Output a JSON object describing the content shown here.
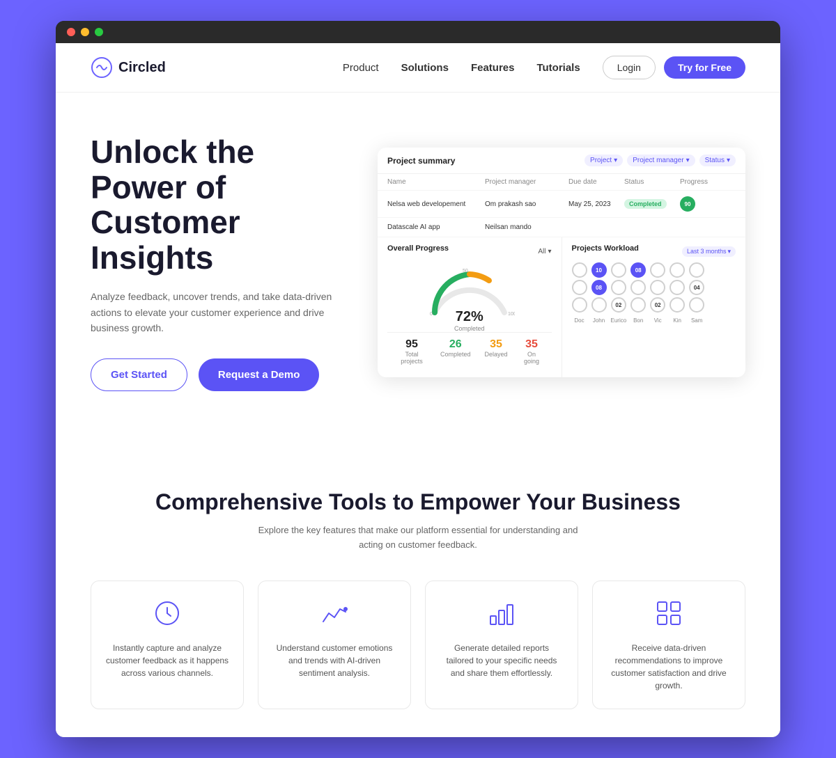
{
  "browser": {
    "dots": [
      "red",
      "yellow",
      "green"
    ]
  },
  "nav": {
    "logo_text": "Circled",
    "links": [
      {
        "label": "Product",
        "bold": false
      },
      {
        "label": "Solutions",
        "bold": true
      },
      {
        "label": "Features",
        "bold": true
      },
      {
        "label": "Tutorials",
        "bold": true
      }
    ],
    "login_label": "Login",
    "try_label": "Try for Free"
  },
  "hero": {
    "title": "Unlock the Power of Customer Insights",
    "subtitle": "Analyze feedback, uncover trends, and take data-driven actions to elevate your customer experience and drive business growth.",
    "btn_started": "Get Started",
    "btn_demo": "Request a Demo"
  },
  "dashboard": {
    "title": "Project summary",
    "filters": [
      "Project",
      "Project manager",
      "Status"
    ],
    "table_headers": [
      "Name",
      "Project manager",
      "Due date",
      "Status",
      "Progress"
    ],
    "rows": [
      {
        "name": "Nelsa web developement",
        "manager": "Om prakash sao",
        "due": "May 25, 2023",
        "status": "Completed",
        "progress": "90%"
      },
      {
        "name": "Datascale AI app",
        "manager": "Neilsan mando",
        "due": "",
        "status": "",
        "progress": ""
      }
    ],
    "overall_progress": {
      "title": "Overall Progress",
      "filter": "All",
      "percentage": "72%",
      "label": "Completed"
    },
    "stats": [
      {
        "num": "95",
        "color": "normal",
        "label": "Total projects"
      },
      {
        "num": "26",
        "color": "green",
        "label": "Completed"
      },
      {
        "num": "35",
        "color": "orange",
        "label": "Delayed"
      },
      {
        "num": "35",
        "color": "red",
        "label": "On going"
      }
    ],
    "workload": {
      "title": "Projects Workload",
      "filter": "Last 3 months",
      "members": [
        {
          "name": "Doc",
          "dots": [
            {
              "val": "",
              "filled": false
            },
            {
              "val": "",
              "filled": false
            },
            {
              "val": "",
              "filled": false
            }
          ]
        },
        {
          "name": "John",
          "dots": [
            {
              "val": "08",
              "filled": true
            },
            {
              "val": "",
              "filled": false
            },
            {
              "val": "",
              "filled": false
            }
          ]
        },
        {
          "name": "Eurico",
          "dots": [
            {
              "val": "",
              "filled": false
            },
            {
              "val": "",
              "filled": false
            },
            {
              "val": "02",
              "filled": false
            }
          ]
        },
        {
          "name": "Bon",
          "dots": [
            {
              "val": "08",
              "filled": true
            },
            {
              "val": "",
              "filled": false
            },
            {
              "val": "",
              "filled": false
            }
          ]
        },
        {
          "name": "Vic",
          "dots": [
            {
              "val": "",
              "filled": false
            },
            {
              "val": "",
              "filled": false
            },
            {
              "val": "02",
              "filled": false
            }
          ]
        },
        {
          "name": "Kin",
          "dots": [
            {
              "val": "",
              "filled": false
            },
            {
              "val": "",
              "filled": false
            },
            {
              "val": "",
              "filled": false
            }
          ]
        },
        {
          "name": "Sam",
          "dots": [
            {
              "val": "",
              "filled": false
            },
            {
              "val": "04",
              "filled": false
            },
            {
              "val": "",
              "filled": false
            }
          ]
        }
      ]
    }
  },
  "tools_section": {
    "title": "Comprehensive Tools to Empower Your Business",
    "subtitle": "Explore the key features that make our platform essential for understanding and acting on customer feedback.",
    "cards": [
      {
        "icon": "clock",
        "text": "Instantly capture and analyze customer feedback as it happens across various channels."
      },
      {
        "icon": "chart-line",
        "text": "Understand customer emotions and trends with AI-driven sentiment analysis."
      },
      {
        "icon": "bar-chart",
        "text": "Generate detailed reports tailored to your specific needs and share them effortlessly."
      },
      {
        "icon": "grid",
        "text": "Receive data-driven recommendations to improve customer satisfaction and drive growth."
      }
    ]
  }
}
